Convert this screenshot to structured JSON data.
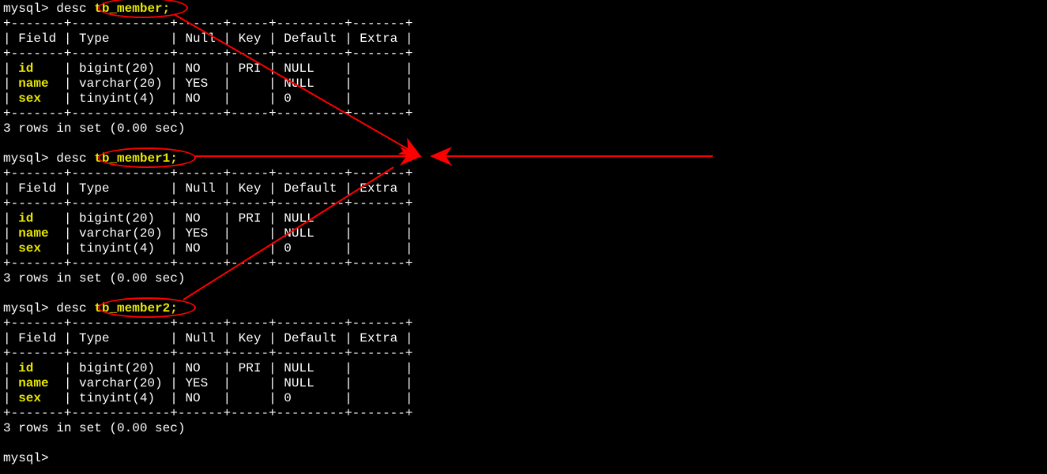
{
  "prompt": "mysql>",
  "cmd_prefix": "desc ",
  "tables": [
    "tb_member;",
    "tb_member1;",
    "tb_member2;"
  ],
  "border": {
    "top": "+-------+-------------+------+-----+---------+-------+",
    "sep": "+-------+-------------+------+-----+---------+-------+",
    "bot": "+-------+-------------+------+-----+---------+-------+"
  },
  "header": "| Field | Type        | Null | Key | Default | Extra |",
  "rows_prefix": "| ",
  "rows": [
    {
      "field": "id",
      "rest": "    | bigint(20)  | NO   | PRI | NULL    |       |"
    },
    {
      "field": "name",
      "rest": "  | varchar(20) | YES  |     | NULL    |       |"
    },
    {
      "field": "sex",
      "rest": "   | tinyint(4)  | NO   |     | 0       |       |"
    }
  ],
  "footer": "3 rows in set (0.00 sec)",
  "blank": "",
  "final_prompt": "mysql> "
}
